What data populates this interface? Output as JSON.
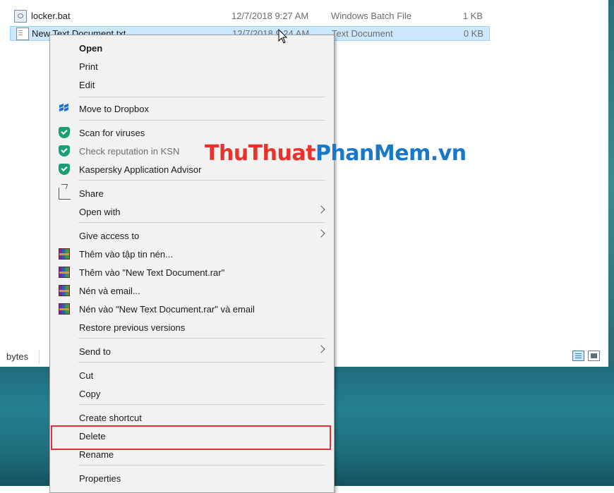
{
  "files": [
    {
      "name": "locker.bat",
      "date": "12/7/2018 9:27 AM",
      "type": "Windows Batch File",
      "size": "1 KB",
      "selected": false
    },
    {
      "name": "New Text Document.txt",
      "date": "12/7/2018 9:24 AM",
      "type": "Text Document",
      "size": "0 KB",
      "selected": true
    }
  ],
  "status": {
    "bytes_label": "bytes"
  },
  "menu": {
    "open": "Open",
    "print": "Print",
    "edit": "Edit",
    "move_to_dropbox": "Move to Dropbox",
    "scan_for_viruses": "Scan for viruses",
    "check_reputation": "Check reputation in KSN",
    "kaspersky_advisor": "Kaspersky Application Advisor",
    "share": "Share",
    "open_with": "Open with",
    "give_access": "Give access to",
    "add_archive": "Thêm vào tập tin nén...",
    "add_to_rar": "Thêm vào \"New Text Document.rar\"",
    "compress_email": "Nén và email...",
    "compress_rar_email": "Nén vào \"New Text Document.rar\" và email",
    "restore_versions": "Restore previous versions",
    "send_to": "Send to",
    "cut": "Cut",
    "copy": "Copy",
    "create_shortcut": "Create shortcut",
    "delete": "Delete",
    "rename": "Rename",
    "properties": "Properties"
  },
  "watermark": {
    "part1": "ThuThuat",
    "part2": "PhanMem.vn"
  },
  "colors": {
    "selection": "#cce8ff",
    "highlight": "#e5303a",
    "kaspersky": "#1a9e75",
    "dropbox": "#1a6fe0"
  }
}
